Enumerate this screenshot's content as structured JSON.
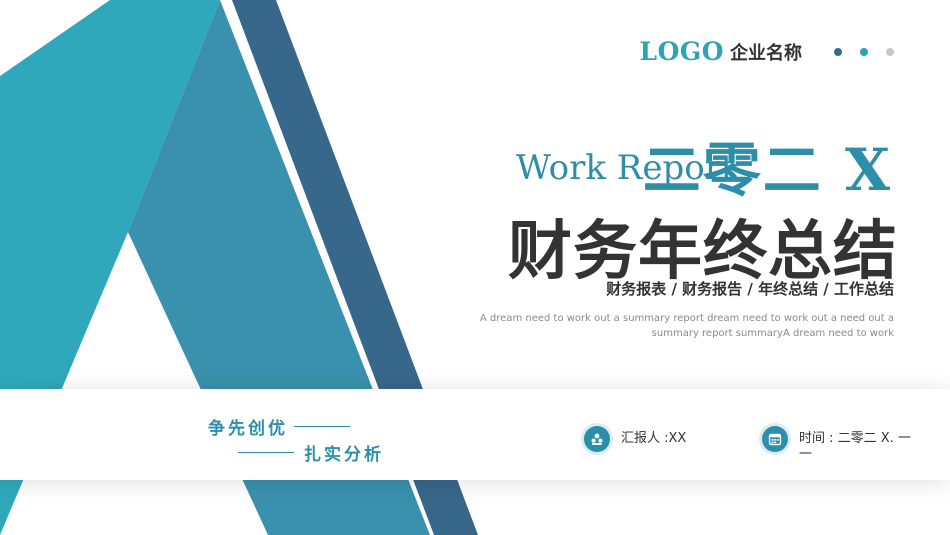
{
  "header": {
    "logo": "LOGO",
    "company": "企业名称",
    "dot_colors": [
      "#356a8c",
      "#2da3b6",
      "#c8c8c8"
    ]
  },
  "title": {
    "subtitle_en": "Work Report",
    "year": "二零二 X",
    "main": "财务年终总结",
    "categories": "财务报表 / 财务报告 / 年终总结 / 工作总结",
    "description": "A dream need to work out a summary report dream need to work out a need out a summary report summaryA dream need to work"
  },
  "slogan": {
    "line1": "争先创优",
    "line2": "扎实分析"
  },
  "info": {
    "reporter": "汇报人 :XX",
    "time": "时间 : 二零二 X. 一一"
  },
  "colors": {
    "teal_light": "#2fa8bc",
    "teal_mid": "#3a8ca8",
    "navy": "#37678a",
    "text_dark": "#333333"
  }
}
